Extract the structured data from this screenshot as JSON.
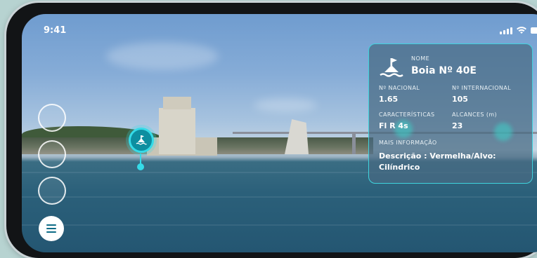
{
  "status_bar": {
    "time": "9:41"
  },
  "buoy_card": {
    "nome_label": "NOME",
    "nome_value": "Boia Nº 40E",
    "nacional_label": "Nº NACIONAL",
    "nacional_value": "1.65",
    "internacional_label": "Nº INTERNACIONAL",
    "internacional_value": "105",
    "caracteristicas_label": "CARACTERÍSTICAS",
    "caracteristicas_value": "Fl R 4s",
    "alcances_label": "ALCANCES (m)",
    "alcances_value": "23",
    "mais_info_label": "MAIS INFORMAÇÃO",
    "descricao": "Descrição : Vermelha/Alvo: Cilíndrico"
  },
  "icons": {
    "buoy": "buoy-icon",
    "menu": "hamburger-menu-icon",
    "signal": "signal-icon",
    "wifi": "wifi-icon",
    "battery": "battery-icon"
  },
  "colors": {
    "accent": "#35dbe8",
    "card_bg": "#46698280"
  }
}
